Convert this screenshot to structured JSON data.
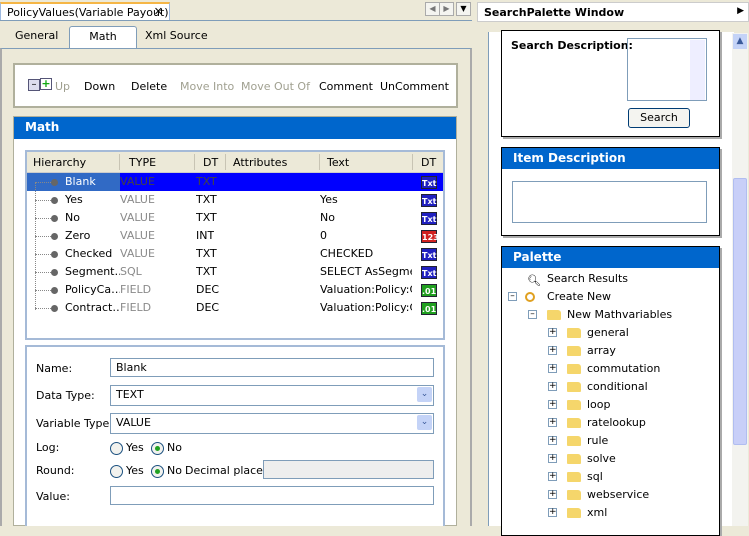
{
  "editor": {
    "tab_title": "PolicyValues(Variable Payout)",
    "close": "✕",
    "subtabs": [
      "General",
      "Math",
      "Xml Source"
    ],
    "active_subtab": "Math",
    "toolbar": {
      "up": "Up",
      "down": "Down",
      "delete": "Delete",
      "move_into": "Move Into",
      "move_out_of": "Move Out Of",
      "comment": "Comment",
      "uncomment": "UnComment"
    },
    "math_header": "Math",
    "grid": {
      "columns": [
        "Hierarchy",
        "TYPE",
        "DT",
        "Attributes",
        "Text",
        "DT"
      ],
      "rows": [
        {
          "name": "Blank",
          "type": "VALUE",
          "dt": "TXT",
          "attributes": "",
          "text": "",
          "icon": "Txt",
          "color": "#2020c0"
        },
        {
          "name": "Yes",
          "type": "VALUE",
          "dt": "TXT",
          "attributes": "",
          "text": "Yes",
          "icon": "Txt",
          "color": "#2020c0"
        },
        {
          "name": "No",
          "type": "VALUE",
          "dt": "TXT",
          "attributes": "",
          "text": "No",
          "icon": "Txt",
          "color": "#2020c0"
        },
        {
          "name": "Zero",
          "type": "VALUE",
          "dt": "INT",
          "attributes": "",
          "text": "0",
          "icon": "123",
          "color": "#d02020"
        },
        {
          "name": "Checked",
          "type": "VALUE",
          "dt": "TXT",
          "attributes": "",
          "text": "CHECKED",
          "icon": "Txt",
          "color": "#2020c0"
        },
        {
          "name": "Segment…",
          "type": "SQL",
          "dt": "TXT",
          "attributes": "",
          "text": "SELECT AsSegment",
          "icon": "Txt",
          "color": "#2020c0"
        },
        {
          "name": "PolicyCa…",
          "type": "FIELD",
          "dt": "DEC",
          "attributes": "",
          "text": "Valuation:Policy:Cas",
          "icon": ".011",
          "color": "#20a020"
        },
        {
          "name": "Contract…",
          "type": "FIELD",
          "dt": "DEC",
          "attributes": "",
          "text": "Valuation:Policy:Cas",
          "icon": ".011",
          "color": "#20a020"
        }
      ]
    },
    "form": {
      "name_label": "Name:",
      "name_value": "Blank",
      "data_type_label": "Data Type:",
      "data_type_value": "TEXT",
      "variable_type_label": "Variable Type:",
      "variable_type_value": "VALUE",
      "log_label": "Log:",
      "round_label": "Round:",
      "yes": "Yes",
      "no": "No",
      "log_selected": "No",
      "round_selected": "No",
      "decimal_places_label": "Decimal places:",
      "decimal_places_value": "",
      "value_label": "Value:",
      "value_value": ""
    }
  },
  "palette_window": {
    "title": "SearchPalette Window",
    "search_description_label": "Search Description:",
    "search_description_value": "",
    "search_button": "Search",
    "item_description_header": "Item Description",
    "item_description_value": "",
    "palette_header": "Palette",
    "tree": {
      "search_results": "Search Results",
      "create_new": "Create New",
      "new_mathvariables": "New Mathvariables",
      "folders": [
        "general",
        "array",
        "commutation",
        "conditional",
        "loop",
        "ratelookup",
        "rule",
        "solve",
        "sql",
        "webservice",
        "xml"
      ]
    }
  }
}
